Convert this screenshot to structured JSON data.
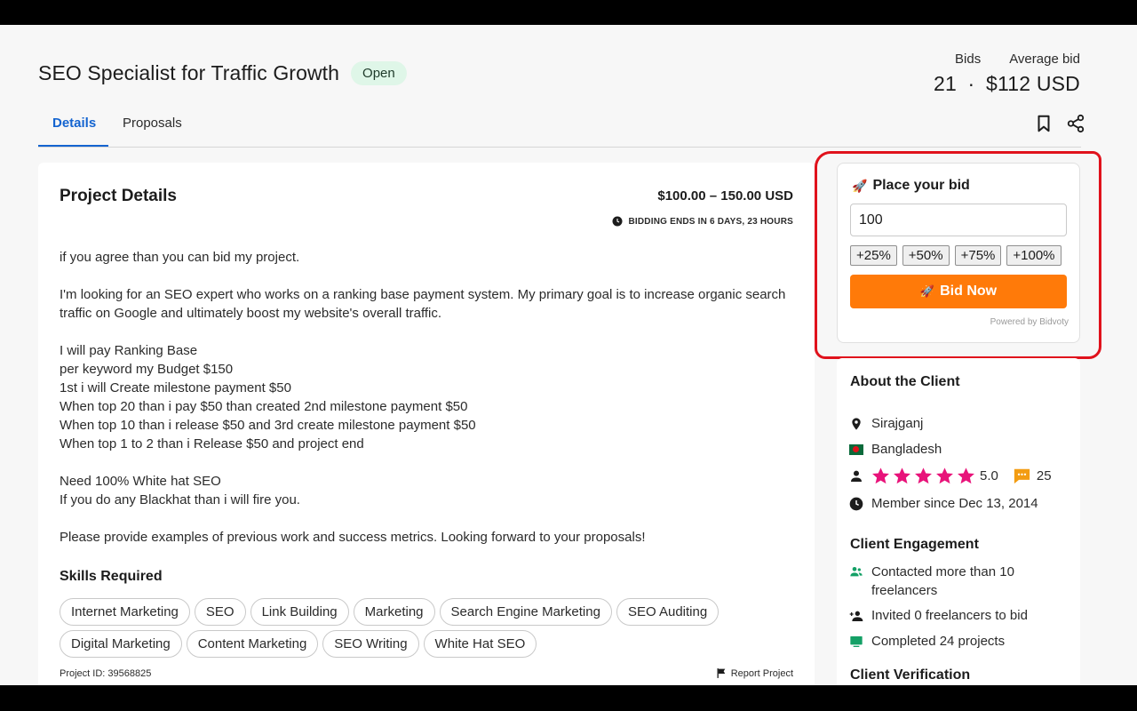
{
  "header": {
    "title": "SEO Specialist for Traffic Growth",
    "status": "Open",
    "bids_label": "Bids",
    "avg_bid_label": "Average bid",
    "bids_count": "21",
    "separator": "·",
    "avg_bid_value": "$112 USD"
  },
  "tabs": [
    {
      "label": "Details",
      "active": true
    },
    {
      "label": "Proposals",
      "active": false
    }
  ],
  "header_icons": [
    "bookmark-icon",
    "share-icon"
  ],
  "project": {
    "heading": "Project Details",
    "budget": "$100.00 – 150.00 USD",
    "bidding_ends": "BIDDING ENDS IN 6 DAYS, 23 HOURS",
    "description": [
      [
        "if you agree than you can bid my project."
      ],
      [
        "I'm looking for an SEO expert who works on a ranking base payment system. My primary goal is to increase organic search traffic on Google and ultimately boost my website's overall traffic."
      ],
      [
        "I will pay Ranking Base",
        "per keyword my Budget $150",
        "1st i will Create milestone payment $50",
        "When top 20 than i pay $50 than created 2nd milestone payment $50",
        "When top 10 than i release $50 and 3rd create milestone payment $50",
        "When top 1 to 2 than i Release $50 and project end"
      ],
      [
        "Need 100% White hat SEO",
        "If you do any Blackhat than i will fire you."
      ],
      [
        "Please provide examples of previous work and success metrics. Looking forward to your proposals!"
      ]
    ],
    "skills_heading": "Skills Required",
    "skills": [
      "Internet Marketing",
      "SEO",
      "Link Building",
      "Marketing",
      "Search Engine Marketing",
      "SEO Auditing",
      "Digital Marketing",
      "Content Marketing",
      "SEO Writing",
      "White Hat SEO"
    ],
    "project_id": "Project ID: 39568825",
    "report_label": "Report Project"
  },
  "bid_widget": {
    "title_emoji": "🚀",
    "title": "Place your bid",
    "input_value": "100",
    "increments": [
      "+25%",
      "+50%",
      "+75%",
      "+100%"
    ],
    "bid_now_emoji": "🚀",
    "bid_now_label": "Bid Now",
    "powered_by": "Powered by Bidvoty"
  },
  "client": {
    "heading": "About the Client",
    "city": "Sirajganj",
    "country": "Bangladesh",
    "rating": "5.0",
    "stars": 5,
    "reviews": "25",
    "member_since": "Member since Dec 13, 2014",
    "engagement_heading": "Client Engagement",
    "contacted": "Contacted more than 10 freelancers",
    "invited": "Invited 0 freelancers to bid",
    "completed": "Completed 24 projects",
    "verification_heading": "Client Verification"
  },
  "colors": {
    "accent_blue": "#1464d0",
    "bid_orange": "#ff7a09",
    "star_pink": "#e8137a",
    "review_orange": "#f39c12",
    "status_green_bg": "#dff6e8",
    "highlight_red": "#e0121c",
    "engagement_green": "#14a066"
  }
}
